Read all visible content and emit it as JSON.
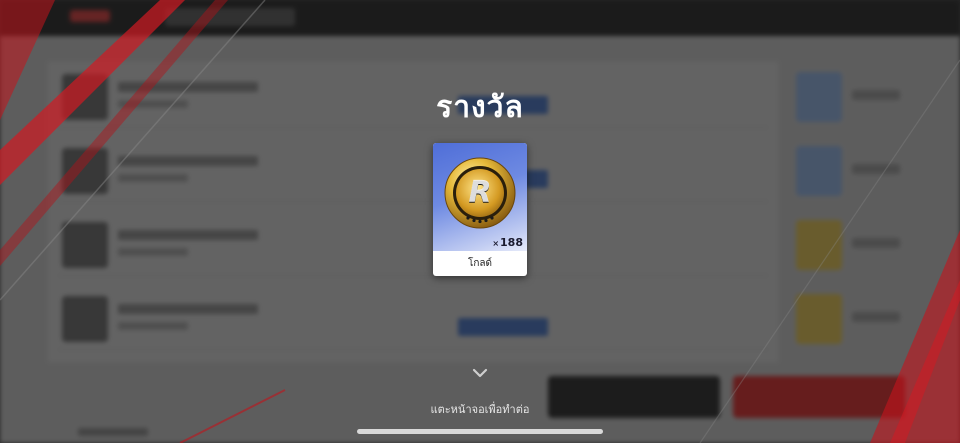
{
  "modal": {
    "title": "รางวัล",
    "hint": "แตะหน้าจอเพื่อทำต่อ"
  },
  "reward": {
    "name": "โกลด์",
    "quantity_prefix": "×",
    "quantity": "188",
    "icon": "gold-coin-icon"
  },
  "colors": {
    "accent_red": "#e02020",
    "card_blue": "#4f6ed8",
    "coin_gold": "#e6b93a"
  }
}
